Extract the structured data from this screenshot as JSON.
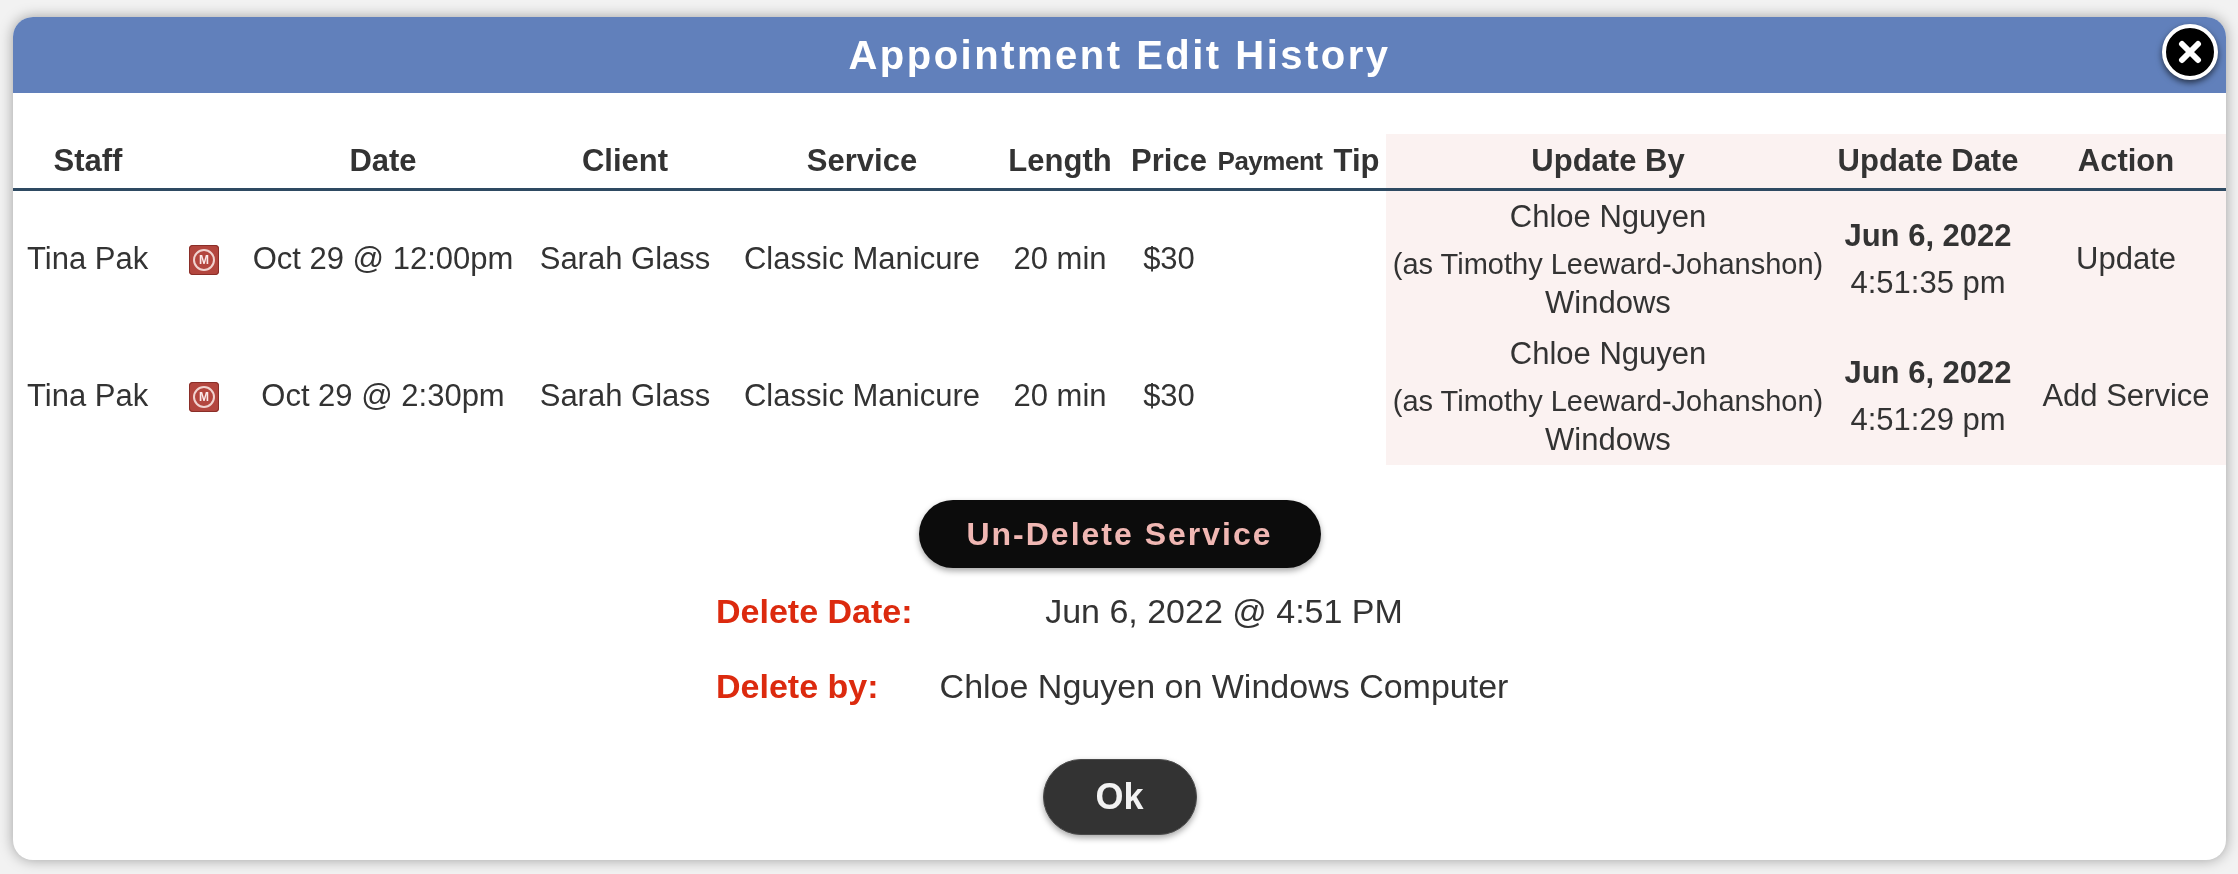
{
  "dialog": {
    "title": "Appointment Edit History"
  },
  "table": {
    "columns": [
      {
        "label": "Staff",
        "highlighted": false
      },
      {
        "label": "Date",
        "highlighted": false
      },
      {
        "label": "Client",
        "highlighted": false
      },
      {
        "label": "Service",
        "highlighted": false
      },
      {
        "label": "Length",
        "highlighted": false
      },
      {
        "label": "Price",
        "highlighted": false
      },
      {
        "label": "Payment",
        "highlighted": false
      },
      {
        "label": "Tip",
        "highlighted": false
      },
      {
        "label": "Update By",
        "highlighted": true
      },
      {
        "label": "Update Date",
        "highlighted": true
      },
      {
        "label": "Action",
        "highlighted": true
      }
    ],
    "rows": [
      {
        "staff": "Tina Pak",
        "badge": "M",
        "date": "Oct 29 @ 12:00pm",
        "client": "Sarah Glass",
        "service": "Classic Manicure",
        "length": "20 min",
        "price": "$30",
        "update_by": {
          "name": "Chloe Nguyen",
          "acting_as": "(as Timothy Leeward-Johanshon)",
          "device": "Windows"
        },
        "update_date": {
          "date": "Jun 6, 2022",
          "time": "4:51:35 pm"
        },
        "action": "Update"
      },
      {
        "staff": "Tina Pak",
        "badge": "M",
        "date": "Oct 29 @ 2:30pm",
        "client": "Sarah Glass",
        "service": "Classic Manicure",
        "length": "20 min",
        "price": "$30",
        "update_by": {
          "name": "Chloe Nguyen",
          "acting_as": "(as Timothy Leeward-Johanshon)",
          "device": "Windows"
        },
        "update_date": {
          "date": "Jun 6, 2022",
          "time": "4:51:29 pm"
        },
        "action": "Add Service"
      }
    ]
  },
  "undelete_button": "Un-Delete Service",
  "deletion": [
    {
      "label": "Delete Date:",
      "value": "Jun 6, 2022 @ 4:51 PM"
    },
    {
      "label": "Delete by:",
      "value": "Chloe Nguyen on Windows Computer"
    }
  ],
  "ok_button": "Ok"
}
